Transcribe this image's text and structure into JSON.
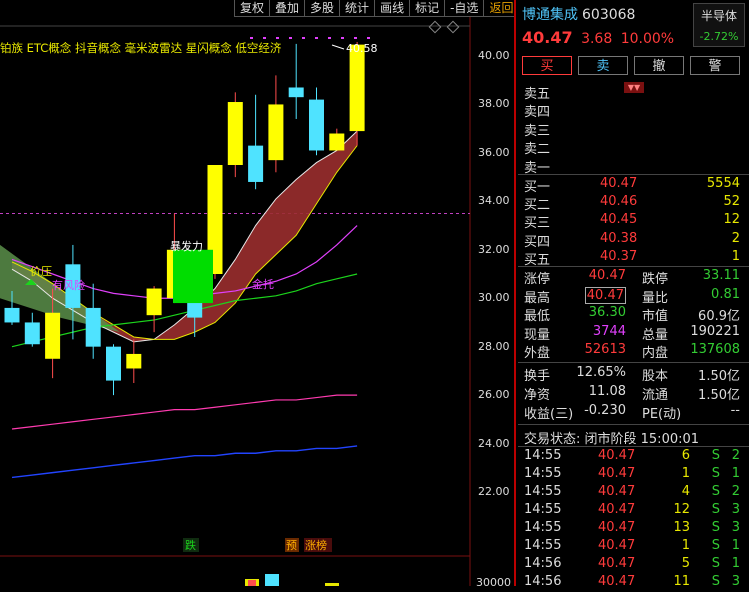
{
  "toolbar": {
    "items": [
      "复权",
      "叠加",
      "多股",
      "统计",
      "画线",
      "标记",
      "-自选",
      "返回"
    ]
  },
  "concepts_text": "铂族 ETC概念 抖音概念 毫米波雷达 星闪概念 低空经济",
  "chart": {
    "y_labels": [
      "40.00",
      "38.00",
      "36.00",
      "34.00",
      "32.00",
      "30.00",
      "28.00",
      "26.00",
      "24.00",
      "22.00"
    ],
    "high_label": "40.58",
    "volume_label": "30000",
    "annotations": {
      "price_pressure": "价压",
      "risk": "有风险",
      "bottom_power": "暴发力",
      "support": "金托",
      "fall": "跌",
      "pre": "预",
      "limit_list": "涨榜"
    },
    "colors": {
      "up": "#ffff00",
      "down": "#4fe3ff",
      "green_box": "#00dd00",
      "cloud": "#9a2e2e",
      "dashed": "#c040c0"
    }
  },
  "chart_data": {
    "type": "candlestick",
    "ylim": [
      21,
      41
    ],
    "candles": [
      {
        "o": 29.6,
        "h": 30.3,
        "l": 28.9,
        "c": 29.0,
        "up": false
      },
      {
        "o": 29.0,
        "h": 29.4,
        "l": 28.0,
        "c": 28.1,
        "up": false
      },
      {
        "o": 27.5,
        "h": 30.4,
        "l": 26.7,
        "c": 29.4,
        "up": true
      },
      {
        "o": 31.4,
        "h": 32.2,
        "l": 28.3,
        "c": 29.6,
        "up": false
      },
      {
        "o": 29.6,
        "h": 30.6,
        "l": 27.5,
        "c": 28.0,
        "up": false
      },
      {
        "o": 28.0,
        "h": 28.1,
        "l": 26.0,
        "c": 26.6,
        "up": false
      },
      {
        "o": 27.1,
        "h": 28.3,
        "l": 26.5,
        "c": 27.7,
        "up": true
      },
      {
        "o": 29.3,
        "h": 30.5,
        "l": 28.6,
        "c": 30.4,
        "up": true
      },
      {
        "o": 30.0,
        "h": 33.5,
        "l": 29.8,
        "c": 32.0,
        "up": true
      },
      {
        "o": 30.1,
        "h": 30.7,
        "l": 28.4,
        "c": 29.2,
        "up": false
      },
      {
        "o": 31.0,
        "h": 32.8,
        "l": 30.8,
        "c": 35.5,
        "up": true
      },
      {
        "o": 35.5,
        "h": 38.5,
        "l": 35.0,
        "c": 38.1,
        "up": true
      },
      {
        "o": 36.3,
        "h": 38.4,
        "l": 34.5,
        "c": 34.8,
        "up": false
      },
      {
        "o": 35.7,
        "h": 39.2,
        "l": 35.2,
        "c": 38.0,
        "up": true
      },
      {
        "o": 38.7,
        "h": 40.5,
        "l": 37.4,
        "c": 38.3,
        "up": false
      },
      {
        "o": 38.2,
        "h": 38.7,
        "l": 35.9,
        "c": 36.1,
        "up": false
      },
      {
        "o": 36.1,
        "h": 37.0,
        "l": 36.3,
        "c": 36.8,
        "up": true
      },
      {
        "o": 36.9,
        "h": 40.58,
        "l": 36.3,
        "c": 40.47,
        "up": true
      }
    ]
  },
  "stock": {
    "name": "博通集成",
    "code": "603068",
    "price": "40.47",
    "change": "3.68",
    "pct": "10.00%",
    "sector": "半导体",
    "sector_pct": "-2.72%"
  },
  "buttons": {
    "buy": "买",
    "sell": "卖",
    "cancel": "撤",
    "alert": "警"
  },
  "sell_levels": [
    "卖五",
    "卖四",
    "卖三",
    "卖二",
    "卖一"
  ],
  "buy_levels": [
    {
      "label": "买一",
      "price": "40.47",
      "vol": "5554"
    },
    {
      "label": "买二",
      "price": "40.46",
      "vol": "52"
    },
    {
      "label": "买三",
      "price": "40.45",
      "vol": "12"
    },
    {
      "label": "买四",
      "price": "40.38",
      "vol": "2"
    },
    {
      "label": "买五",
      "price": "40.37",
      "vol": "1"
    }
  ],
  "stats": [
    {
      "l1": "涨停",
      "v1": "40.47",
      "l2": "跌停",
      "v2": "33.11"
    },
    {
      "l1": "最高",
      "v1": "40.47",
      "l2": "量比",
      "v2": "0.81"
    },
    {
      "l1": "最低",
      "v1": "36.30",
      "l2": "市值",
      "v2": "60.9亿"
    },
    {
      "l1": "现量",
      "v1": "3744",
      "l2": "总量",
      "v2": "190221"
    },
    {
      "l1": "外盘",
      "v1": "52613",
      "l2": "内盘",
      "v2": "137608"
    }
  ],
  "stats2": [
    {
      "l1": "换手",
      "v1": "12.65%",
      "l2": "股本",
      "v2": "1.50亿"
    },
    {
      "l1": "净资",
      "v1": "11.08",
      "l2": "流通",
      "v2": "1.50亿"
    },
    {
      "l1": "收益(三)",
      "v1": "-0.230",
      "l2": "PE(动)",
      "v2": "--"
    }
  ],
  "trade_status": "交易状态: 闭市阶段 15:00:01",
  "ticks": [
    {
      "t": "14:55",
      "p": "40.47",
      "v": "6",
      "s": "S",
      "n": "2"
    },
    {
      "t": "14:55",
      "p": "40.47",
      "v": "1",
      "s": "S",
      "n": "1"
    },
    {
      "t": "14:55",
      "p": "40.47",
      "v": "4",
      "s": "S",
      "n": "2"
    },
    {
      "t": "14:55",
      "p": "40.47",
      "v": "12",
      "s": "S",
      "n": "3"
    },
    {
      "t": "14:55",
      "p": "40.47",
      "v": "13",
      "s": "S",
      "n": "3"
    },
    {
      "t": "14:55",
      "p": "40.47",
      "v": "1",
      "s": "S",
      "n": "1"
    },
    {
      "t": "14:56",
      "p": "40.47",
      "v": "5",
      "s": "S",
      "n": "1"
    },
    {
      "t": "14:56",
      "p": "40.47",
      "v": "11",
      "s": "S",
      "n": "3"
    }
  ]
}
